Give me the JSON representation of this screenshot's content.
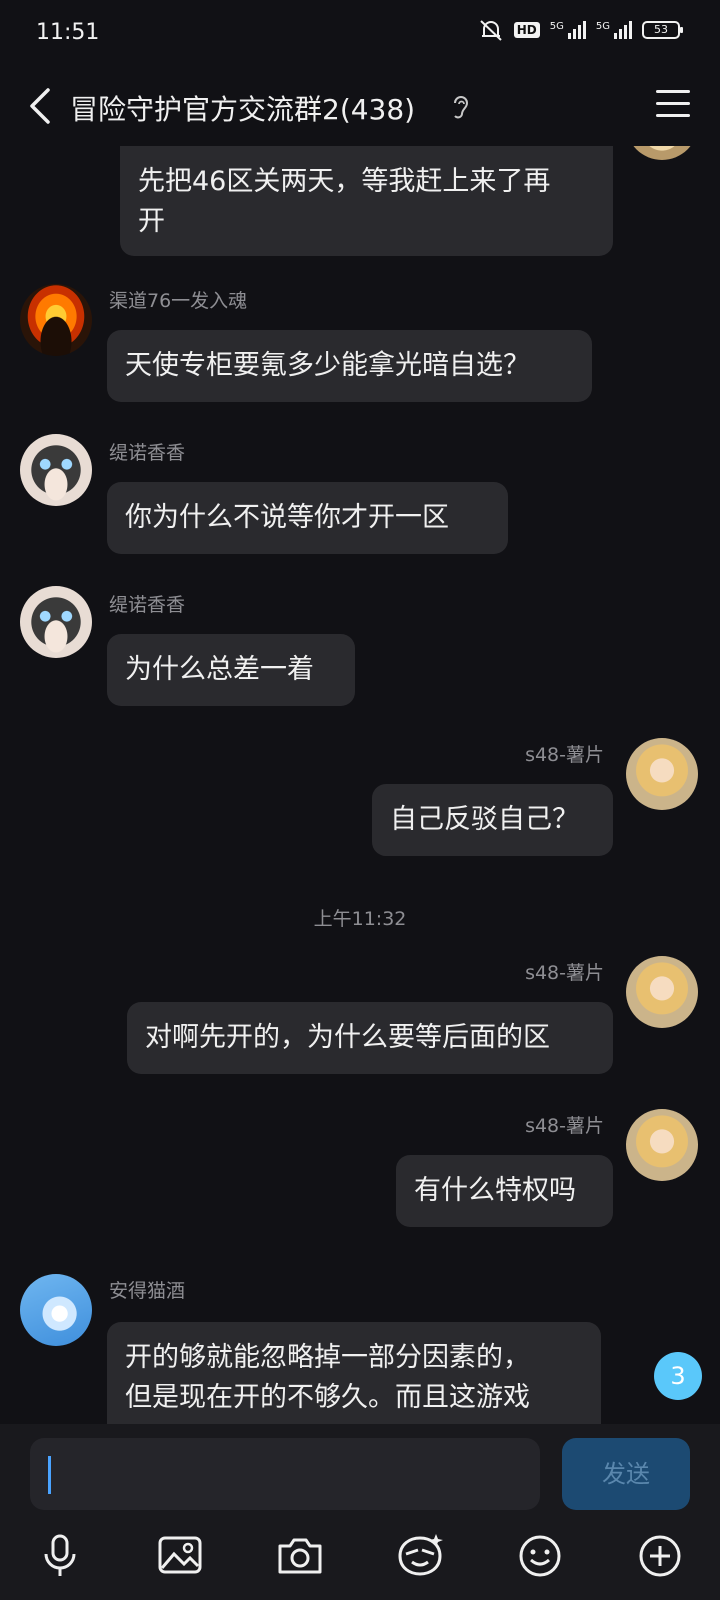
{
  "status": {
    "time": "11:51",
    "hd": "HD",
    "net1": "5G",
    "net2": "5G",
    "battery": "53"
  },
  "header": {
    "title": "冒险守护官方交流群2(438)"
  },
  "messages": [
    {
      "text_lines": [
        "先把46区关两天，等我赶上来了再",
        "开"
      ]
    },
    {
      "sender": "渠道76一发入魂",
      "text": "天使专柜要氪多少能拿光暗自选？"
    },
    {
      "sender": "缇诺香香",
      "text": "你为什么不说等你才开一区"
    },
    {
      "sender": "缇诺香香",
      "text": "为什么总差一着"
    },
    {
      "sender": "s48-薯片",
      "text": "自己反驳自己？"
    },
    {
      "sender": "s48-薯片",
      "text": "对啊先开的，为什么要等后面的区"
    },
    {
      "sender": "s48-薯片",
      "text": "有什么特权吗"
    },
    {
      "sender": "安得猫酒",
      "text_lines": [
        "开的够就能忽略掉一部分因素的，",
        "但是现在开的不够久。而且这游戏"
      ]
    }
  ],
  "timestamp": "上午11:32",
  "unread_count": "3",
  "composer": {
    "send_label": "发送"
  },
  "toolbar_icons": [
    "microphone-icon",
    "image-icon",
    "camera-icon",
    "sticker-icon",
    "emoji-icon",
    "plus-icon"
  ]
}
